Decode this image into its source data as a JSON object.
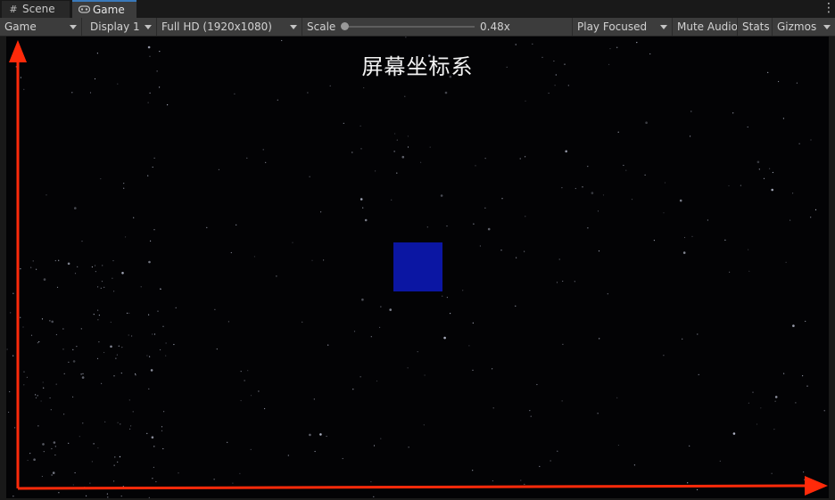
{
  "tabs": [
    {
      "label": "Scene",
      "icon": "grid-icon"
    },
    {
      "label": "Game",
      "icon": "gamepad-icon",
      "active": true
    }
  ],
  "toolbar": {
    "view_select": "Game",
    "display_select": "Display 1",
    "resolution_select": "Full HD (1920x1080)",
    "scale_label": "Scale",
    "scale_value": "0.48x",
    "play_mode_select": "Play Focused",
    "mute_audio": "Mute Audio",
    "stats": "Stats",
    "gizmos": "Gizmos"
  },
  "game": {
    "title": "屏幕坐标系",
    "cube_color": "#0b16a3",
    "axis_color": "#ff2a0a"
  }
}
